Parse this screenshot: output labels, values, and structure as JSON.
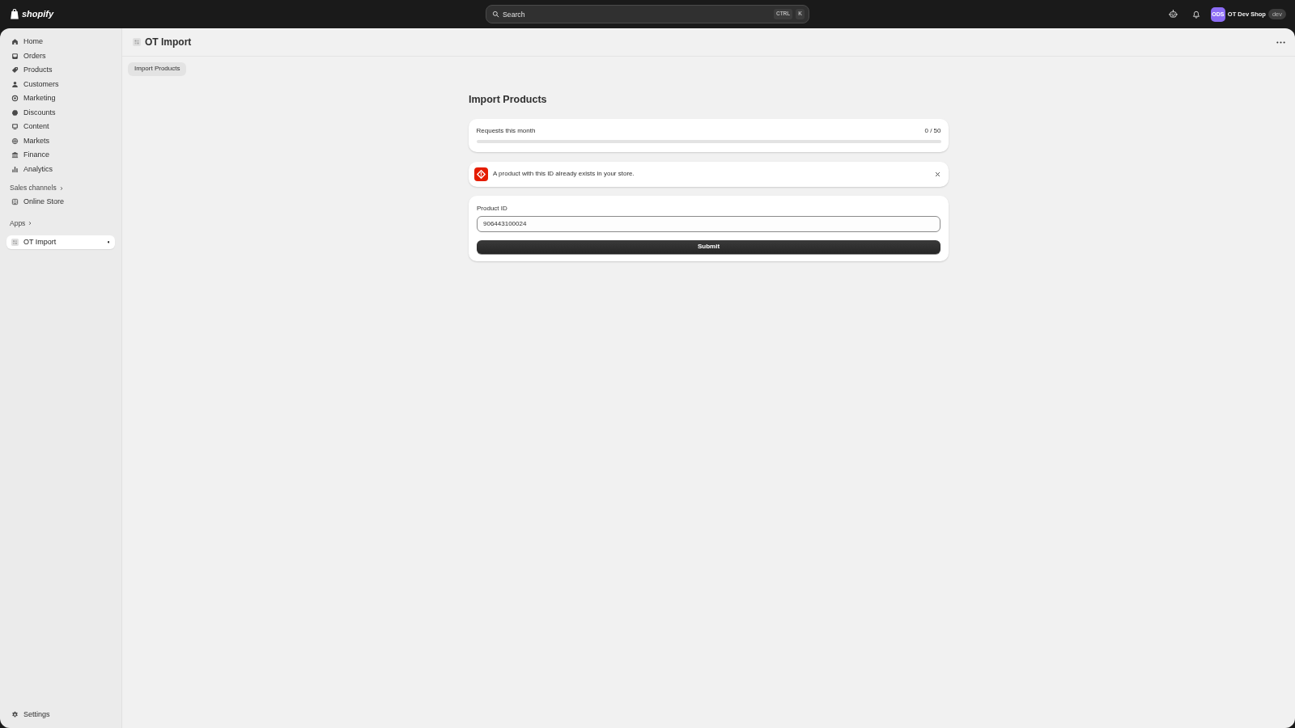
{
  "top_bar": {
    "logo": {
      "text": "shopify"
    },
    "search": {
      "placeholder": "Search",
      "shortcut_keys": [
        "CTRL",
        "K"
      ]
    },
    "store": {
      "initials": "ODS",
      "name": "OT Dev Shop",
      "tag": "dev"
    }
  },
  "sidebar": {
    "items": [
      {
        "label": "Home",
        "selected": false
      },
      {
        "label": "Orders",
        "selected": false
      },
      {
        "label": "Products",
        "selected": false
      },
      {
        "label": "Customers",
        "selected": false
      },
      {
        "label": "Marketing",
        "selected": false
      },
      {
        "label": "Discounts",
        "selected": false
      },
      {
        "label": "Content",
        "selected": false
      },
      {
        "label": "Markets",
        "selected": false
      },
      {
        "label": "Finance",
        "selected": false
      },
      {
        "label": "Analytics",
        "selected": false
      }
    ],
    "sales_channels": {
      "title": "Sales channels",
      "items": [
        {
          "label": "Online Store",
          "selected": false
        }
      ]
    },
    "apps": {
      "title": "Apps",
      "items": [
        {
          "label": "OT Import",
          "selected": true
        }
      ]
    },
    "settings": {
      "label": "Settings",
      "selected": false
    }
  },
  "page_header": {
    "title": "OT Import"
  },
  "tabs": [
    {
      "label": "Import Products",
      "selected": true
    }
  ],
  "content": {
    "title": "Import Products",
    "usage": {
      "label": "Requests this month",
      "reading": "0 / 50",
      "level": 0
    },
    "banner": {
      "kind": "critical",
      "message": "A product with this ID already exists in your store."
    },
    "form": {
      "label": "Product ID",
      "value": "906443100024",
      "submit": "Submit"
    }
  }
}
